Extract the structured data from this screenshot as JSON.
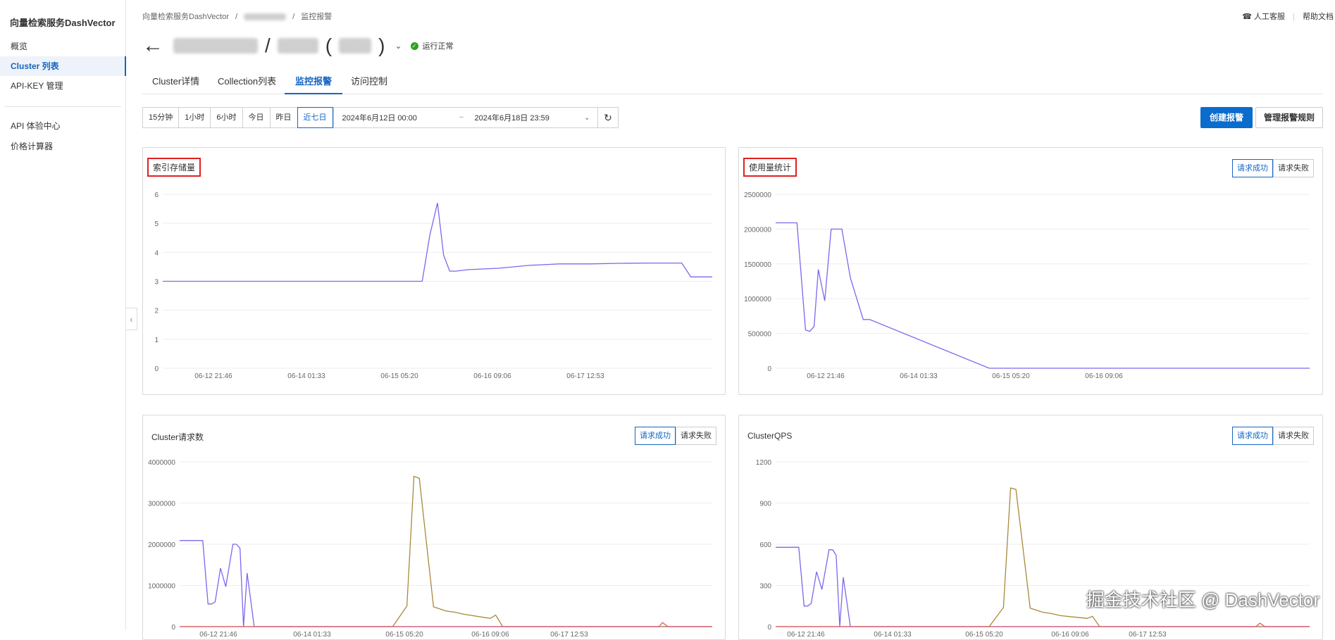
{
  "sidebar": {
    "product": "向量检索服务DashVector",
    "items": [
      {
        "label": "概览",
        "active": false
      },
      {
        "label": "Cluster 列表",
        "active": true
      },
      {
        "label": "API-KEY 管理",
        "active": false
      },
      {
        "label": "API 体验中心",
        "active": false
      },
      {
        "label": "价格计算器",
        "active": false
      }
    ]
  },
  "breadcrumb": {
    "root": "向量检索服务DashVector",
    "sep": "/",
    "current": "监控报警"
  },
  "topbar": {
    "support": "人工客服",
    "help": "帮助文档"
  },
  "header": {
    "slash": "/",
    "paren_open": "(",
    "paren_close": ")",
    "status": "运行正常"
  },
  "tabs": [
    {
      "label": "Cluster详情",
      "active": false
    },
    {
      "label": "Collection列表",
      "active": false
    },
    {
      "label": "监控报警",
      "active": true
    },
    {
      "label": "访问控制",
      "active": false
    }
  ],
  "time_ranges": [
    {
      "label": "15分钟",
      "active": false
    },
    {
      "label": "1小时",
      "active": false
    },
    {
      "label": "6小时",
      "active": false
    },
    {
      "label": "今日",
      "active": false
    },
    {
      "label": "昨日",
      "active": false
    },
    {
      "label": "近七日",
      "active": true
    }
  ],
  "date_range": {
    "start": "2024年6月12日 00:00",
    "sep": "~",
    "end": "2024年6月18日 23:59"
  },
  "actions": {
    "create": "创建报警",
    "manage": "管理报警规则"
  },
  "toggle": {
    "success": "请求成功",
    "fail": "请求失败"
  },
  "colors": {
    "accent": "#1565c0",
    "series_purple": "#7b68ee",
    "series_brown": "#a8893a",
    "series_red": "#e05a6a",
    "series_blue": "#5b8ff9"
  },
  "watermark": "掘金技术社区 @ DashVector",
  "chart_data": [
    {
      "type": "line",
      "title": "索引存储量",
      "ylim": [
        0,
        6
      ],
      "yticks": [
        0,
        1,
        2,
        3,
        4,
        5,
        6
      ],
      "xticks": [
        "06-12 21:46",
        "06-14 01:33",
        "06-15 05:20",
        "06-16 09:06",
        "06-17 12:53"
      ],
      "x": [
        0,
        8.5,
        8.75,
        9,
        9.2,
        9.4,
        9.6,
        10,
        11,
        12,
        13,
        14,
        15,
        16,
        17,
        17.3,
        18
      ],
      "series": [
        {
          "values": [
            3,
            3,
            4.6,
            5.7,
            3.9,
            3.35,
            3.35,
            3.4,
            3.45,
            3.55,
            3.6,
            3.6,
            3.62,
            3.63,
            3.63,
            3.15,
            3.15
          ]
        }
      ]
    },
    {
      "type": "line",
      "title": "使用量统计",
      "ylim": [
        0,
        2500000
      ],
      "yticks": [
        0,
        500000,
        1000000,
        1500000,
        2000000,
        2500000
      ],
      "xticks": [
        "06-12 21:46",
        "06-14 01:33",
        "06-15 05:20",
        "06-16 09:06"
      ],
      "x": [
        0,
        0.5,
        1,
        1.4,
        1.6,
        1.8,
        2.0,
        2.3,
        2.6,
        3.1,
        3.5,
        4.1,
        4.4,
        10,
        25
      ],
      "series": [
        {
          "values": [
            2090000,
            2090000,
            2090000,
            550000,
            530000,
            600000,
            1420000,
            970000,
            2000000,
            2000000,
            1300000,
            700000,
            700000,
            0,
            0
          ]
        }
      ]
    },
    {
      "type": "line",
      "title": "Cluster请求数",
      "ylim": [
        0,
        4000000
      ],
      "yticks": [
        0,
        1000000,
        2000000,
        3000000,
        4000000
      ],
      "xticks": [
        "06-12 21:46",
        "06-14 01:33",
        "06-15 05:20",
        "06-16 09:06",
        "06-17 12:53"
      ],
      "x": [
        0,
        1,
        1.3,
        1.6,
        1.8,
        2.0,
        2.3,
        2.6,
        3.0,
        3.2,
        3.4,
        3.6,
        3.8,
        4.2,
        12,
        12.8,
        13.2,
        13.5,
        14.3,
        15,
        15.5,
        16,
        17.5,
        17.8,
        18.2,
        18.5,
        25,
        27,
        27.2,
        27.5,
        30
      ],
      "series": [
        {
          "values": [
            2090000,
            2090000,
            2090000,
            550000,
            550000,
            600000,
            1420000,
            970000,
            2000000,
            2000000,
            1900000,
            0,
            1300000,
            0,
            0,
            0,
            0,
            0,
            0,
            0,
            0,
            0,
            0,
            0,
            0,
            0,
            0,
            0,
            0,
            0,
            0
          ]
        },
        {
          "values": [
            0,
            0,
            0,
            0,
            0,
            0,
            0,
            0,
            0,
            0,
            0,
            0,
            0,
            0,
            0,
            500000,
            3650000,
            3600000,
            480000,
            380000,
            350000,
            300000,
            200000,
            280000,
            0,
            0,
            0,
            0,
            0,
            0,
            0
          ]
        },
        {
          "values": [
            0,
            0,
            0,
            0,
            0,
            0,
            0,
            0,
            0,
            0,
            0,
            0,
            0,
            0,
            0,
            0,
            0,
            0,
            0,
            0,
            0,
            0,
            0,
            0,
            0,
            0,
            0,
            0,
            100000,
            0,
            0
          ]
        }
      ]
    },
    {
      "type": "line",
      "title": "ClusterQPS",
      "ylim": [
        0,
        1200
      ],
      "yticks": [
        0,
        300,
        600,
        900,
        1200
      ],
      "xticks": [
        "06-12 21:46",
        "06-14 01:33",
        "06-15 05:20",
        "06-16 09:06",
        "06-17 12:53"
      ],
      "x": [
        0,
        1,
        1.3,
        1.6,
        1.8,
        2.0,
        2.3,
        2.6,
        3.0,
        3.2,
        3.4,
        3.6,
        3.8,
        4.2,
        12,
        12.8,
        13.2,
        13.5,
        14.3,
        15,
        15.5,
        16,
        17.5,
        17.8,
        18.2,
        18.5,
        25,
        27,
        27.2,
        27.5,
        30
      ],
      "series": [
        {
          "values": [
            578,
            578,
            578,
            150,
            150,
            170,
            400,
            270,
            560,
            560,
            520,
            0,
            360,
            0,
            0,
            0,
            0,
            0,
            0,
            0,
            0,
            0,
            0,
            0,
            0,
            0,
            0,
            0,
            0,
            0,
            0
          ]
        },
        {
          "values": [
            0,
            0,
            0,
            0,
            0,
            0,
            0,
            0,
            0,
            0,
            0,
            0,
            0,
            0,
            0,
            140,
            1010,
            1000,
            135,
            105,
            95,
            80,
            60,
            75,
            0,
            0,
            0,
            0,
            0,
            0,
            0
          ]
        },
        {
          "values": [
            0,
            0,
            0,
            0,
            0,
            0,
            0,
            0,
            0,
            0,
            0,
            0,
            0,
            0,
            0,
            0,
            0,
            0,
            0,
            0,
            0,
            0,
            0,
            0,
            0,
            0,
            0,
            0,
            25,
            0,
            0
          ]
        }
      ]
    }
  ]
}
